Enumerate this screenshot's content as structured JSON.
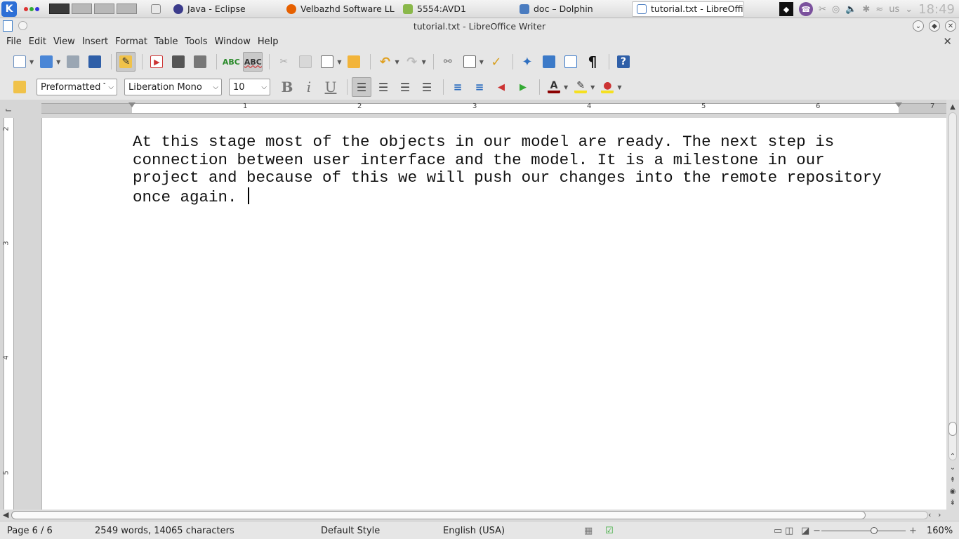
{
  "taskbar": {
    "start_label": "K",
    "tasks": [
      {
        "label": "Java - Eclipse",
        "color": "#3c3c8c"
      },
      {
        "label": "Velbazhd Software LLC",
        "color": "#e66000"
      },
      {
        "label": "5554:AVD1",
        "color": "#8ab84a"
      },
      {
        "label": "doc – Dolphin",
        "color": "#4a7cc0"
      },
      {
        "label": "tutorial.txt - LibreOffic",
        "color": "#4a7cc0"
      }
    ],
    "tray_language": "us",
    "clock": "18:49"
  },
  "window": {
    "title": "tutorial.txt - LibreOffice Writer"
  },
  "menu": {
    "items": [
      "File",
      "Edit",
      "View",
      "Insert",
      "Format",
      "Table",
      "Tools",
      "Window",
      "Help"
    ]
  },
  "formatting": {
    "paragraph_style": "Preformatted Te",
    "font_name": "Liberation Mono",
    "font_size": "10"
  },
  "ruler": {
    "h_numbers": [
      "1",
      "2",
      "3",
      "4",
      "5",
      "6",
      "7"
    ],
    "v_numbers": [
      "2",
      "3",
      "4",
      "5"
    ]
  },
  "document": {
    "text": "At this stage most of the objects in our model are ready. The next step is\nconnection between user interface and the model. It is a milestone in our\nproject and because of this we will push our changes into the remote repository\nonce again. "
  },
  "status": {
    "page": "Page 6 / 6",
    "word_count": "2549 words, 14065 characters",
    "page_style": "Default Style",
    "language": "English (USA)",
    "zoom": "160%"
  }
}
